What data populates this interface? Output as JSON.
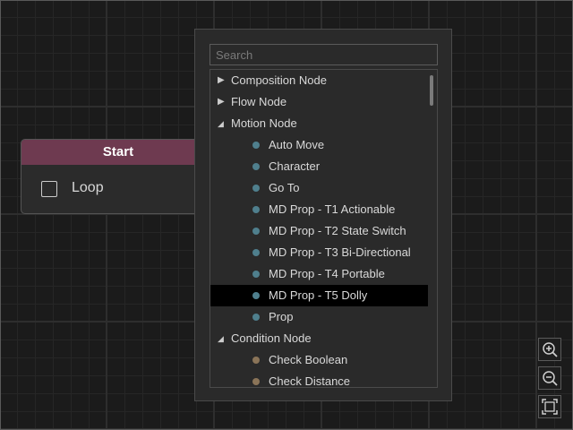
{
  "node": {
    "title": "Start",
    "loop_label": "Loop",
    "header_color": "#6e3a50"
  },
  "search": {
    "placeholder": "Search"
  },
  "colors": {
    "motion_dot": "#4f7f8d",
    "condition_dot": "#8a7458"
  },
  "tree": {
    "composition": {
      "label": "Composition Node",
      "expanded": false,
      "icon": "triangle-right-icon"
    },
    "flow": {
      "label": "Flow Node",
      "expanded": false,
      "icon": "triangle-right-icon"
    },
    "motion": {
      "label": "Motion Node",
      "expanded": true,
      "icon": "triangle-down-icon",
      "items": [
        "Auto Move",
        "Character",
        "Go To",
        "MD Prop - T1 Actionable",
        "MD Prop - T2 State Switch",
        "MD Prop - T3 Bi-Directional",
        "MD Prop - T4 Portable",
        "MD Prop - T5 Dolly",
        "Prop"
      ],
      "selected": "MD Prop - T5 Dolly"
    },
    "condition": {
      "label": "Condition Node",
      "expanded": true,
      "icon": "triangle-down-icon",
      "items": [
        "Check Boolean",
        "Check Distance"
      ]
    }
  },
  "zoom_controls": {
    "icons": [
      "zoom-in-icon",
      "zoom-out-icon",
      "fit-view-icon"
    ]
  }
}
